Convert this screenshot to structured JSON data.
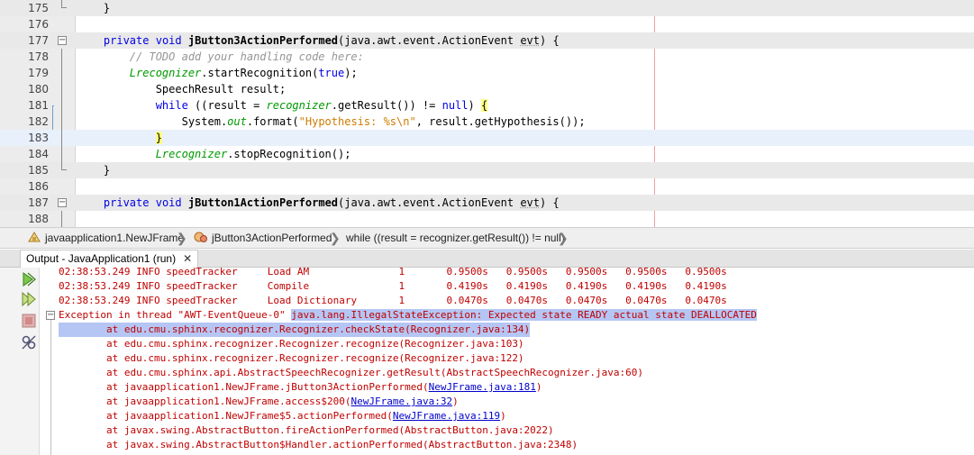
{
  "editor": {
    "lines": [
      {
        "num": "175",
        "code": "    }"
      },
      {
        "num": "176",
        "code": ""
      },
      {
        "num": "177",
        "code": "    private void jButton3ActionPerformed(java.awt.event.ActionEvent evt) {"
      },
      {
        "num": "178",
        "code": "        // TODO add your handling code here:"
      },
      {
        "num": "179",
        "code": "        Lrecognizer.startRecognition(true);"
      },
      {
        "num": "180",
        "code": "            SpeechResult result;"
      },
      {
        "num": "181",
        "code": "            while ((result = recognizer.getResult()) != null) {"
      },
      {
        "num": "182",
        "code": "                System.out.format(\"Hypothesis: %s\\n\", result.getHypothesis());"
      },
      {
        "num": "183",
        "code": "            }"
      },
      {
        "num": "184",
        "code": "            Lrecognizer.stopRecognition();"
      },
      {
        "num": "185",
        "code": "    }"
      },
      {
        "num": "186",
        "code": ""
      },
      {
        "num": "187",
        "code": "    private void jButton1ActionPerformed(java.awt.event.ActionEvent evt) {"
      },
      {
        "num": "188",
        "code": ""
      }
    ],
    "fold_open_glyph": "−"
  },
  "breadcrumb": {
    "items": [
      {
        "label": "javaapplication1.NewJFrame",
        "icon": "class-icon"
      },
      {
        "label": "jButton3ActionPerformed",
        "icon": "method-icon"
      },
      {
        "label": "while ((result = recognizer.getResult()) != null)",
        "icon": ""
      }
    ],
    "separator": "❯"
  },
  "output": {
    "tab_label": "Output - JavaApplication1 (run)",
    "tab_close": "✕",
    "toolbar": [
      {
        "name": "rerun-icon"
      },
      {
        "name": "rerun-with-options-icon"
      },
      {
        "name": "stop-icon"
      },
      {
        "name": "settings-icon"
      }
    ],
    "fold_glyph": "−",
    "lines": [
      {
        "text": "02:38:53.249 INFO speedTracker     Load AM               1       0.9500s   0.9500s   0.9500s   0.9500s   0.9500s",
        "indent": 0
      },
      {
        "text": "02:38:53.249 INFO speedTracker     Compile               1       0.4190s   0.4190s   0.4190s   0.4190s   0.4190s",
        "indent": 0
      },
      {
        "text": "02:38:53.249 INFO speedTracker     Load Dictionary       1       0.0470s   0.0470s   0.0470s   0.0470s   0.0470s",
        "indent": 0
      },
      {
        "prefix": "Exception in thread \"AWT-EventQueue-0\" ",
        "text": "java.lang.IllegalStateException: Expected state READY actual state DEALLOCATED",
        "indent": -1
      },
      {
        "text": "        at edu.cmu.sphinx.recognizer.Recognizer.checkState(Recognizer.java:134)",
        "indent": 0
      },
      {
        "text": "        at edu.cmu.sphinx.recognizer.Recognizer.recognize(Recognizer.java:103)",
        "indent": 0
      },
      {
        "text": "        at edu.cmu.sphinx.recognizer.Recognizer.recognize(Recognizer.java:122)",
        "indent": 0
      },
      {
        "text": "        at edu.cmu.sphinx.api.AbstractSpeechRecognizer.getResult(AbstractSpeechRecognizer.java:60)",
        "indent": 0
      },
      {
        "prefix": "        at javaapplication1.NewJFrame.jButton3ActionPerformed(",
        "link": "NewJFrame.java:181",
        "suffix": ")"
      },
      {
        "prefix": "        at javaapplication1.NewJFrame.access$200(",
        "link": "NewJFrame.java:32",
        "suffix": ")"
      },
      {
        "prefix": "        at javaapplication1.NewJFrame$5.actionPerformed(",
        "link": "NewJFrame.java:119",
        "suffix": ")"
      },
      {
        "text": "        at javax.swing.AbstractButton.fireActionPerformed(AbstractButton.java:2022)",
        "indent": 0
      },
      {
        "text": "        at javax.swing.AbstractButton$Handler.actionPerformed(AbstractButton.java:2348)",
        "indent": 0
      }
    ]
  },
  "colors": {
    "keyword": "#0000e6",
    "comment": "#969696",
    "string": "#ce7b00",
    "field": "#009900",
    "error_output": "#c00000",
    "selection": "#b5c6f4",
    "link": "#0000cc"
  }
}
